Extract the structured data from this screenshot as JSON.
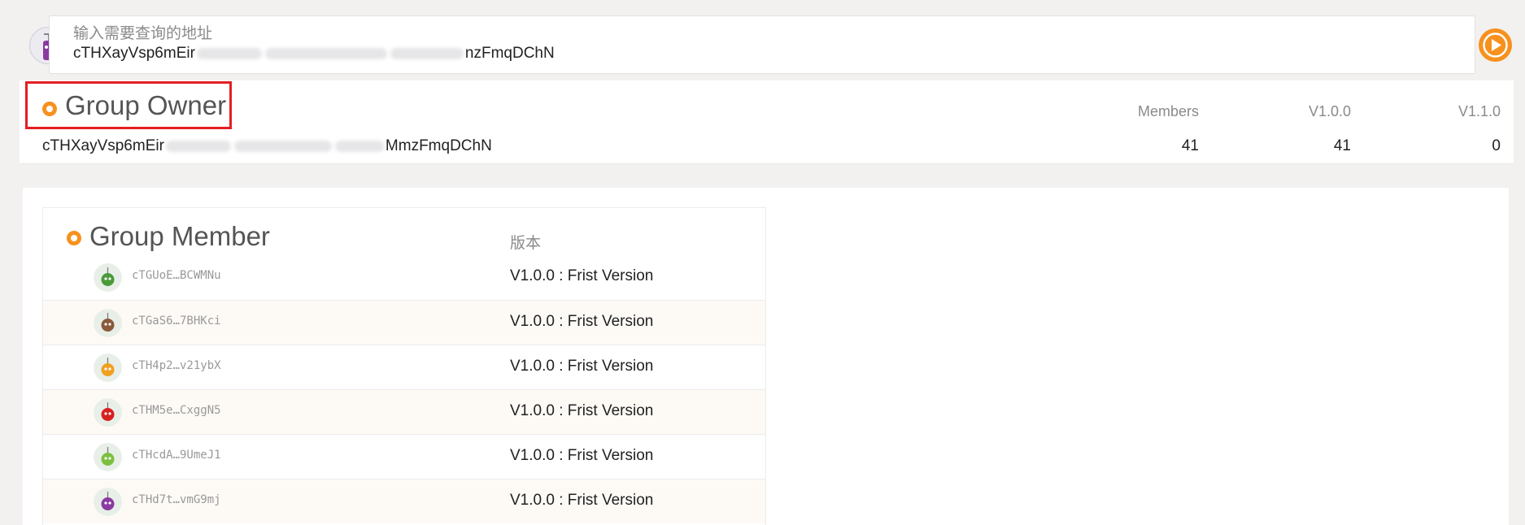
{
  "search": {
    "placeholder": "输入需要查询的地址",
    "value_start": "cTHXayVsp6mEir",
    "value_end": "nzFmqDChN"
  },
  "owner": {
    "title": "Group Owner",
    "address_start": "cTHXayVsp6mEir",
    "address_end": "MmzFmqDChN",
    "columns": [
      "Members",
      "V1.0.0",
      "V1.1.0"
    ],
    "values": [
      "41",
      "41",
      "0"
    ]
  },
  "members": {
    "title": "Group Member",
    "version_header": "版本",
    "rows": [
      {
        "address": "cTGUoE…BCWMNu",
        "version": "V1.0.0 : Frist Version",
        "avatar_color": "#4a9a3a"
      },
      {
        "address": "cTGaS6…7BHKci",
        "version": "V1.0.0 : Frist Version",
        "avatar_color": "#8a5a3a"
      },
      {
        "address": "cTH4p2…v21ybX",
        "version": "V1.0.0 : Frist Version",
        "avatar_color": "#f0a020"
      },
      {
        "address": "cTHM5e…CxggN5",
        "version": "V1.0.0 : Frist Version",
        "avatar_color": "#d82020"
      },
      {
        "address": "cTHcdA…9UmeJ1",
        "version": "V1.0.0 : Frist Version",
        "avatar_color": "#7cc040"
      },
      {
        "address": "cTHd7t…vmG9mj",
        "version": "V1.0.0 : Frist Version",
        "avatar_color": "#8a3aa0"
      }
    ]
  },
  "colors": {
    "accent": "#f7911e",
    "highlight": "#e51e22"
  }
}
